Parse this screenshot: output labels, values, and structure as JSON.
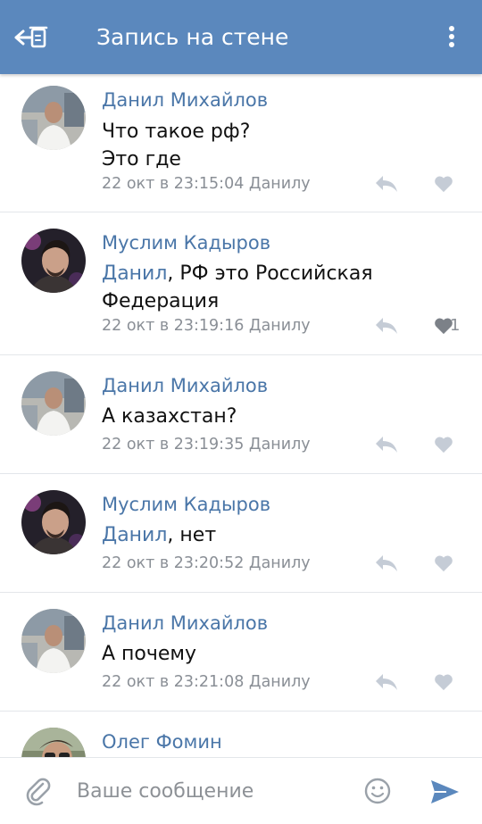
{
  "header": {
    "title": "Запись на стене",
    "back_icon": "back-arrow-icon",
    "menu_icon": "more-vertical-icon",
    "background": "#5b88bd"
  },
  "comments": [
    {
      "author": "Данил Михайлов",
      "mention": "",
      "text": "Что такое рф?\nЭто где",
      "meta": "22 окт в 23:15:04 Данилу",
      "likes": ""
    },
    {
      "author": "Муслим Кадыров",
      "mention": "Данил",
      "text": ", РФ это Российская Федерация",
      "meta": "22 окт в 23:19:16 Данилу",
      "likes": "1"
    },
    {
      "author": "Данил Михайлов",
      "mention": "",
      "text": "А казахстан?",
      "meta": "22 окт в 23:19:35 Данилу",
      "likes": ""
    },
    {
      "author": "Муслим Кадыров",
      "mention": "Данил",
      "text": ", нет",
      "meta": "22 окт в 23:20:52 Данилу",
      "likes": ""
    },
    {
      "author": "Данил Михайлов",
      "mention": "",
      "text": "А почему",
      "meta": "22 окт в 23:21:08 Данилу",
      "likes": ""
    },
    {
      "author": "Олег Фомин",
      "mention": "",
      "text": "",
      "meta": "",
      "likes": ""
    }
  ],
  "composer": {
    "placeholder": "Ваше сообщение",
    "attach_icon": "paperclip-icon",
    "emoji_icon": "smiley-icon",
    "send_icon": "send-icon"
  },
  "colors": {
    "accent": "#4a76a8",
    "meta_text": "#8a8f96",
    "icons": "#c5ccd6"
  }
}
